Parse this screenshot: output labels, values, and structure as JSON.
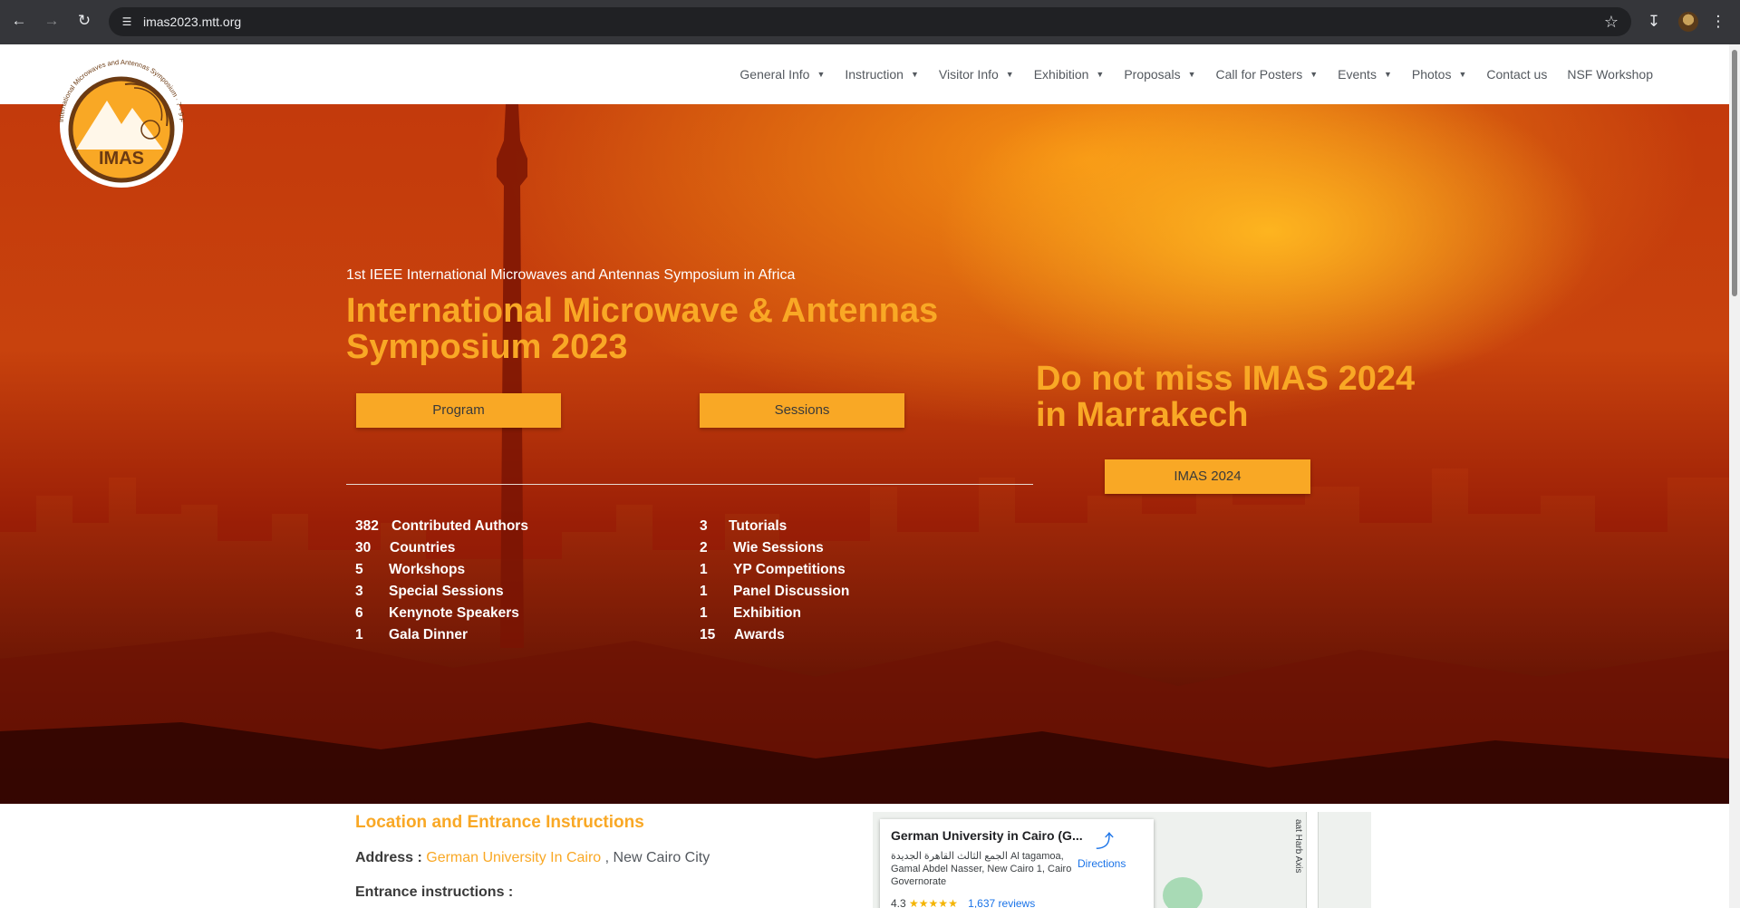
{
  "browser": {
    "url": "imas2023.mtt.org"
  },
  "site": {
    "logo_text": "IMAS",
    "logo_ring_text": "International Microwaves and Antennas Symposium · 7 - 9 Feb 2023",
    "nav": [
      {
        "label": "General Info",
        "dropdown": true
      },
      {
        "label": "Instruction",
        "dropdown": true
      },
      {
        "label": "Visitor Info",
        "dropdown": true
      },
      {
        "label": "Exhibition",
        "dropdown": true
      },
      {
        "label": "Proposals",
        "dropdown": true
      },
      {
        "label": "Call for Posters",
        "dropdown": true
      },
      {
        "label": "Events",
        "dropdown": true
      },
      {
        "label": "Photos",
        "dropdown": true
      },
      {
        "label": "Contact us",
        "dropdown": false
      },
      {
        "label": "NSF Workshop",
        "dropdown": false
      }
    ]
  },
  "hero": {
    "subtitle": "1st IEEE International Microwaves and Antennas Symposium in Africa",
    "title": "International Microwave & Antennas Symposium 2023",
    "program_button": "Program",
    "sessions_button": "Sessions",
    "stats_left": [
      {
        "num": "382",
        "label": "Contributed Authors"
      },
      {
        "num": "30",
        "label": "Countries"
      },
      {
        "num": "5",
        "label": "Workshops"
      },
      {
        "num": "3",
        "label": "Special Sessions"
      },
      {
        "num": "6",
        "label": "Kenynote Speakers"
      },
      {
        "num": "1",
        "label": "Gala Dinner"
      }
    ],
    "stats_right": [
      {
        "num": "3",
        "label": "Tutorials"
      },
      {
        "num": "2",
        "label": "Wie Sessions"
      },
      {
        "num": "1",
        "label": "YP Competitions"
      },
      {
        "num": "1",
        "label": "Panel Discussion"
      },
      {
        "num": "1",
        "label": "Exhibition"
      },
      {
        "num": "15",
        "label": "Awards"
      }
    ],
    "promo_title": "Do not miss IMAS 2024 in Marrakech",
    "promo_button": "IMAS 2024"
  },
  "location": {
    "title": "Location and Entrance Instructions",
    "address_label": "Address :",
    "address_link": "German University In Cairo",
    "address_rest": ", New Cairo City",
    "entrance_label": "Entrance instructions :"
  },
  "map": {
    "place_name": "German University in Cairo (G...",
    "address": "الجمع الثالث القاهرة الجديدة Al tagamoa, Gamal Abdel Nasser, New Cairo 1, Cairo Governorate",
    "directions": "Directions",
    "rating": "4.3",
    "stars": "★★★★★",
    "reviews": "1,637 reviews",
    "road_label": "aat Harb Axis"
  },
  "colors": {
    "accent": "#f9a825",
    "nav_text": "#54595f",
    "hero_dark": "#9a1e06"
  }
}
